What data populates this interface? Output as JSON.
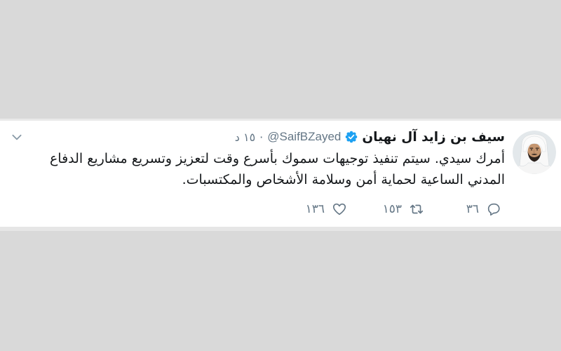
{
  "tweet": {
    "author": {
      "name": "سيف بن زايد آل نهيان",
      "handle": "@SaifBZayed",
      "verified": true,
      "avatar_icon": "avatar-photo"
    },
    "separator": "·",
    "time": "١٥ د",
    "text": "أمرك سيدي. سيتم تنفيذ توجيهات سموك بأسرع وقت لتعزيز وتسريع مشاريع الدفاع\nالمدني الساعية لحماية أمن وسلامة الأشخاص والمكتسبات.",
    "menu_icon": "chevron-down-icon",
    "actions": {
      "reply": {
        "icon": "reply-icon",
        "count": "٣٦"
      },
      "retweet": {
        "icon": "retweet-icon",
        "count": "١٥٣"
      },
      "like": {
        "icon": "heart-icon",
        "count": "١٣٦"
      }
    }
  },
  "colors": {
    "page_background": "#d9d9d9",
    "card_background": "#ffffff",
    "text_primary": "#14171a",
    "text_secondary": "#657786",
    "verified_blue": "#1da1f2"
  }
}
